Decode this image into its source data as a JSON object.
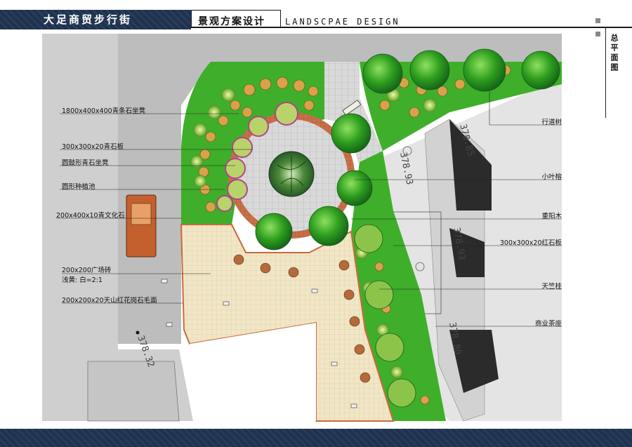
{
  "header": {
    "project_title": "大足商贸步行街",
    "design_title_cn": "景观方案设计",
    "design_title_en": "LANDSCPAE DESIGN",
    "sheet_title": "总平面图"
  },
  "left_labels": [
    "1800x400x400青条石坐凳",
    "300x300x20青石板",
    "圆鼓形青石坐凳",
    "圆形种植池",
    "200x400x10青文化石",
    "200x200广场砖",
    "浅黄: 白=2:1",
    "200x200x20天山红花岗石毛面"
  ],
  "right_labels": [
    "行道树",
    "小叶榕",
    "重阳木",
    "300x300x20红石板",
    "天竺桂",
    "商业茶座"
  ],
  "elevations": [
    "378.85",
    "378.93",
    "378.93",
    "378.80",
    "378.32"
  ],
  "colors": {
    "header_navy": "#1f3351",
    "lawn": "#3fae2a",
    "road_gray": "#bdbdbd",
    "paving_beige": "#efe3c0",
    "red_paving": "#c86a3c",
    "tree_green": "#2e9e1e"
  }
}
